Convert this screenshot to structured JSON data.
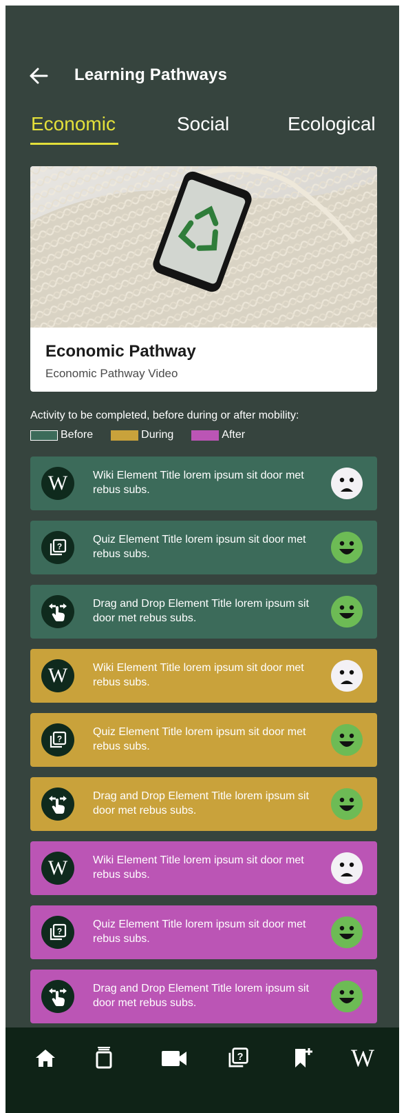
{
  "header": {
    "title": "Learning Pathways",
    "back_icon": "arrow-left-icon"
  },
  "tabs": [
    {
      "label": "Economic",
      "active": true
    },
    {
      "label": "Social",
      "active": false
    },
    {
      "label": "Ecological",
      "active": false
    }
  ],
  "pathway_card": {
    "title": "Economic Pathway",
    "subtitle": "Economic Pathway Video",
    "media": "phone-with-recycling-logo-on-mesh-bag"
  },
  "legend": {
    "text": "Activity to be completed, before during or after mobility:",
    "items": [
      {
        "label": "Before",
        "color": "#3c6b5a"
      },
      {
        "label": "During",
        "color": "#c9a23b"
      },
      {
        "label": "After",
        "color": "#bb55b5"
      }
    ]
  },
  "activities": [
    {
      "type": "wiki",
      "icon": "wikipedia-icon",
      "title": "Wiki Element Title lorem ipsum sit door met rebus subs.",
      "phase": "before",
      "status": "sad"
    },
    {
      "type": "quiz",
      "icon": "quiz-icon",
      "title": "Quiz Element Title lorem ipsum sit door met rebus subs.",
      "phase": "before",
      "status": "happy"
    },
    {
      "type": "drag",
      "icon": "drag-drop-icon",
      "title": "Drag and Drop Element Title lorem ipsum sit  door met rebus subs.",
      "phase": "before",
      "status": "happy"
    },
    {
      "type": "wiki",
      "icon": "wikipedia-icon",
      "title": "Wiki Element Title lorem ipsum sit door met rebus subs.",
      "phase": "during",
      "status": "sad"
    },
    {
      "type": "quiz",
      "icon": "quiz-icon",
      "title": "Quiz Element Title lorem ipsum sit door met rebus subs.",
      "phase": "during",
      "status": "happy"
    },
    {
      "type": "drag",
      "icon": "drag-drop-icon",
      "title": "Drag and Drop Element Title lorem ipsum sit  door met rebus subs.",
      "phase": "during",
      "status": "happy"
    },
    {
      "type": "wiki",
      "icon": "wikipedia-icon",
      "title": "Wiki Element Title lorem ipsum sit door met rebus subs.",
      "phase": "after",
      "status": "sad"
    },
    {
      "type": "quiz",
      "icon": "quiz-icon",
      "title": "Quiz Element Title lorem ipsum sit door met rebus subs.",
      "phase": "after",
      "status": "happy"
    },
    {
      "type": "drag",
      "icon": "drag-drop-icon",
      "title": "Drag and Drop Element Title lorem ipsum sit  door met rebus subs.",
      "phase": "after",
      "status": "happy"
    }
  ],
  "bottom_nav": [
    {
      "icon": "home-icon"
    },
    {
      "icon": "book-stack-icon"
    },
    {
      "icon": "video-camera-icon"
    },
    {
      "icon": "quiz-icon"
    },
    {
      "icon": "bookmark-add-icon"
    },
    {
      "icon": "wikipedia-icon",
      "glyph": "W"
    }
  ],
  "colors": {
    "background": "#36443e",
    "accent": "#e3e03a",
    "before": "#3c6b5a",
    "during": "#c9a23b",
    "after": "#bb55b5",
    "nav_background": "#0f2317",
    "happy_face": "#6dbb55",
    "sad_face": "#f3f1f5"
  }
}
